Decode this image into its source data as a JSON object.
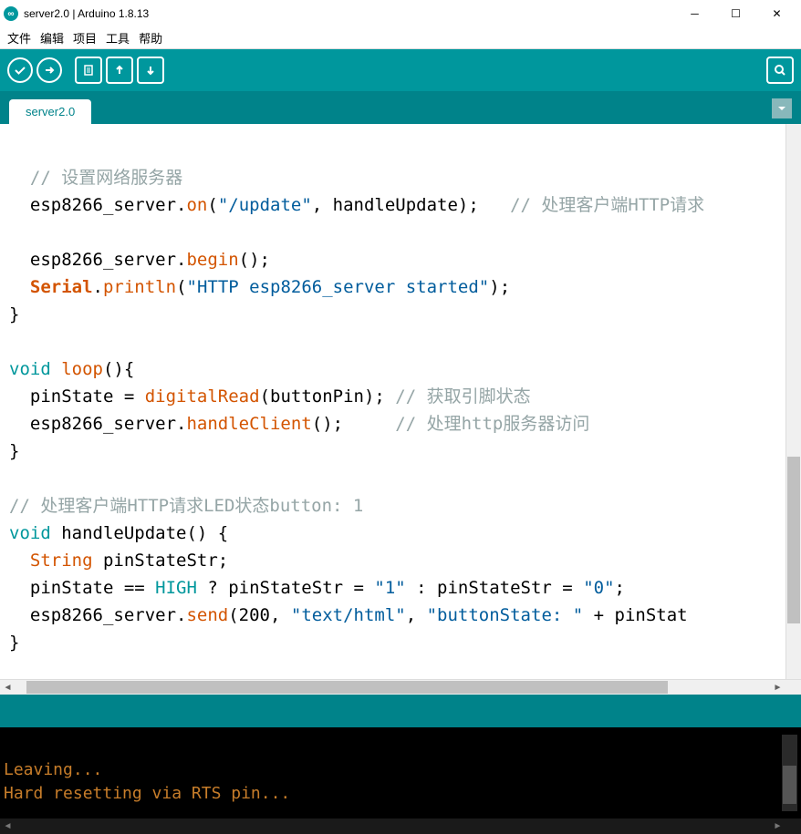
{
  "window": {
    "title": "server2.0 | Arduino 1.8.13"
  },
  "menu": {
    "file": "文件",
    "edit": "编辑",
    "sketch": "项目",
    "tools": "工具",
    "help": "帮助"
  },
  "tab": {
    "name": "server2.0"
  },
  "code": {
    "c1": "  // 设置网络服务器",
    "l2a": "  esp8266_server.",
    "l2b": "on",
    "l2c": "(",
    "l2d": "\"/update\"",
    "l2e": ", handleUpdate);   ",
    "l2f": "// 处理客户端HTTP请求",
    "l4a": "  esp8266_server.",
    "l4b": "begin",
    "l4c": "();",
    "l5a": "  ",
    "l5b": "Serial",
    "l5c": ".",
    "l5d": "println",
    "l5e": "(",
    "l5f": "\"HTTP esp8266_server started\"",
    "l5g": ");",
    "l6": "}",
    "l8a": "void",
    "l8b": " ",
    "l8c": "loop",
    "l8d": "(){",
    "l9a": "  pinState = ",
    "l9b": "digitalRead",
    "l9c": "(buttonPin); ",
    "l9d": "// 获取引脚状态",
    "l10a": "  esp8266_server.",
    "l10b": "handleClient",
    "l10c": "();     ",
    "l10d": "// 处理http服务器访问",
    "l11": "}",
    "l13": "// 处理客户端HTTP请求LED状态button: 1",
    "l14a": "void",
    "l14b": " handleUpdate() {",
    "l15a": "  ",
    "l15b": "String",
    "l15c": " pinStateStr;",
    "l16a": "  pinState == ",
    "l16b": "HIGH",
    "l16c": " ? pinStateStr = ",
    "l16d": "\"1\"",
    "l16e": " : pinStateStr = ",
    "l16f": "\"0\"",
    "l16g": ";",
    "l17a": "  esp8266_server.",
    "l17b": "send",
    "l17c": "(200, ",
    "l17d": "\"text/html\"",
    "l17e": ", ",
    "l17f": "\"buttonState: \"",
    "l17g": " + pinStat",
    "l18": "}"
  },
  "console": {
    "line1": "Leaving...",
    "line2": "Hard resetting via RTS pin..."
  }
}
